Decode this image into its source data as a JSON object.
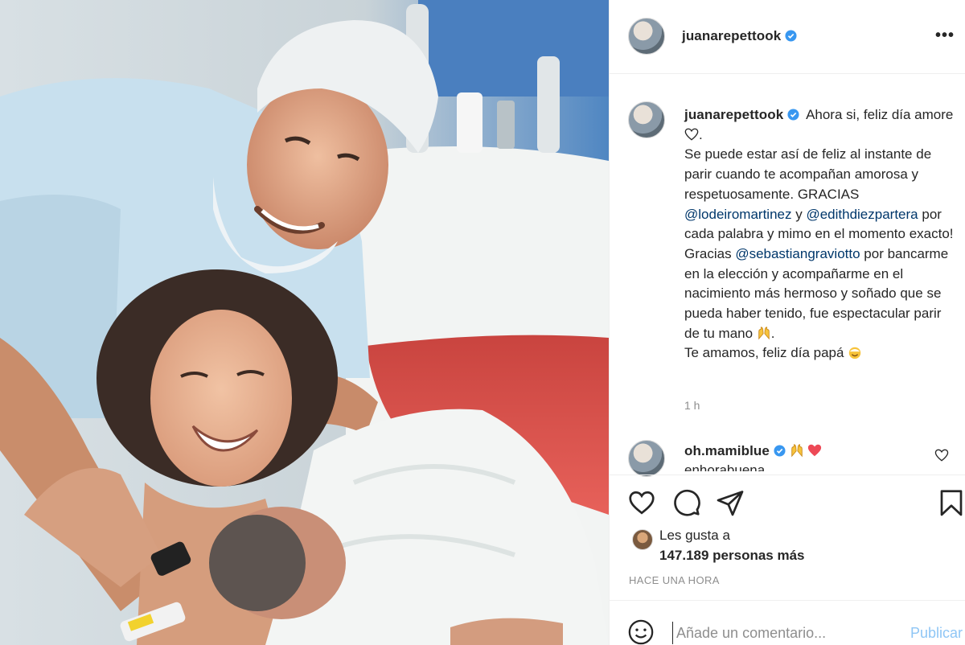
{
  "post": {
    "username": "juanarepettook",
    "more_icon": "more-horizontal-icon"
  },
  "caption": {
    "username": "juanarepettook",
    "text_1": "Ahora si, feliz día amore",
    "text_2": ".",
    "text_3": "Se puede estar así de feliz al instante de parir cuando te acompañan amorosa y respetuosamente.",
    "text_4": "GRACIAS",
    "mention_1": "@lodeiromartinez",
    "text_5": "y",
    "mention_2": "@edithdiezpartera",
    "text_6": "por cada palabra y mimo en el momento exacto! Gracias",
    "mention_3": "@sebastiangraviotto",
    "text_7": "por bancarme en la elección y acompañarme en el nacimiento más hermoso y soñado que se pueda haber tenido, fue espectacular parir de tu mano",
    "text_8": ".",
    "text_9": "Te amamos, feliz día papá",
    "time": "1 h"
  },
  "comment": {
    "username": "oh.mamiblue",
    "text": "enhorabuena"
  },
  "likes": {
    "line_1": "Les gusta a",
    "line_2": "147.189 personas más"
  },
  "timestamp": "HACE UNA HORA",
  "add_comment": {
    "placeholder": "Añade un comentario...",
    "publish_label": "Publicar"
  },
  "colors": {
    "link": "#00376b",
    "verified": "#3897f0",
    "publish": "#8fc6f5",
    "heart_red": "#ed4956"
  }
}
